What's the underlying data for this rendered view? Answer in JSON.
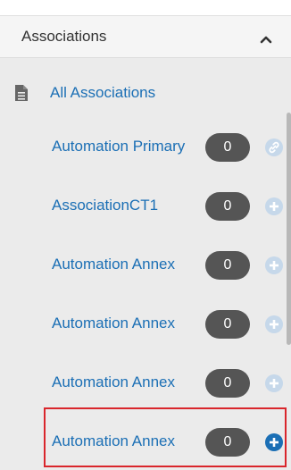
{
  "panel": {
    "title": "Associations"
  },
  "all_associations": {
    "label": "All Associations"
  },
  "associations": [
    {
      "label": "Automation Primary",
      "count": "0",
      "action_icon": "link-icon"
    },
    {
      "label": "AssociationCT1",
      "count": "0",
      "action_icon": "add-icon"
    },
    {
      "label": "Automation Annex",
      "count": "0",
      "action_icon": "add-icon"
    },
    {
      "label": "Automation Annex",
      "count": "0",
      "action_icon": "add-icon"
    },
    {
      "label": "Automation Annex",
      "count": "0",
      "action_icon": "add-icon"
    },
    {
      "label": "Automation Annex",
      "count": "0",
      "action_icon": "add-icon",
      "highlighted": true
    }
  ],
  "colors": {
    "link": "#1b6fb5",
    "badge": "#555555",
    "icon_faded": "#c6d8ea",
    "icon_active": "#1b6fb5",
    "highlight": "#d9262c"
  }
}
